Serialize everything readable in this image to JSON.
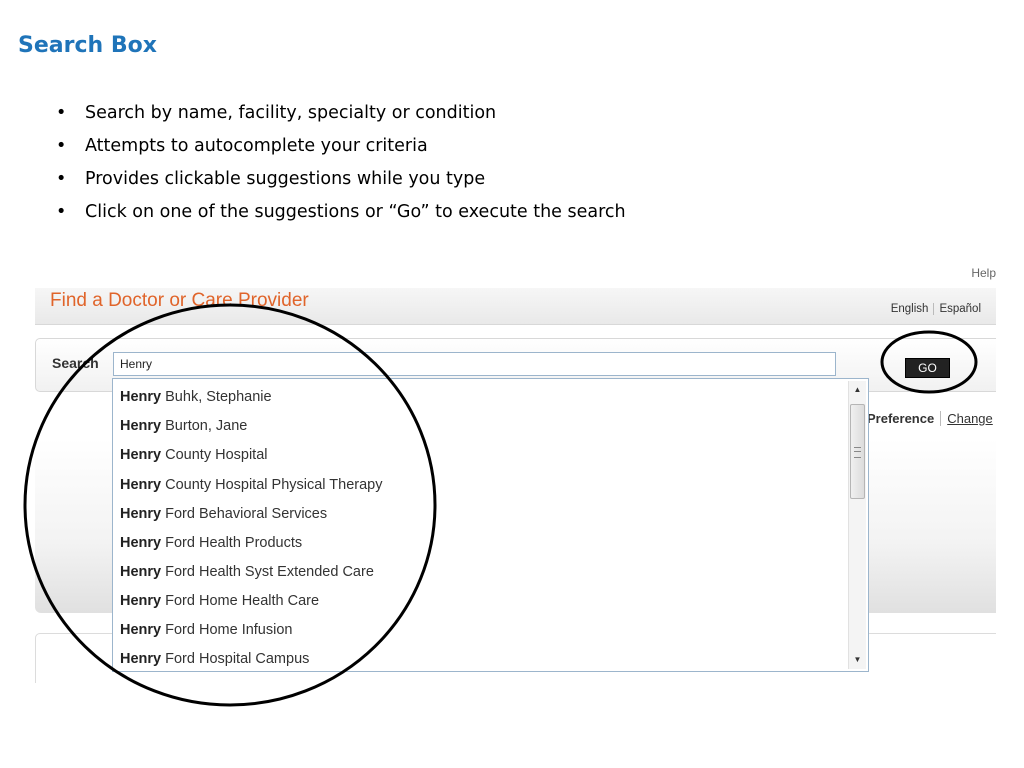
{
  "slide": {
    "title": "Search Box",
    "bullet_char": "•",
    "bullets": [
      "Search by name, facility, specialty or condition",
      "Attempts to autocomplete your criteria",
      "Provides clickable suggestions while you type",
      "Click on one of the suggestions or “Go” to execute the search"
    ]
  },
  "app": {
    "help_link": "Help",
    "title": "Find a Doctor or Care Provider",
    "languages": [
      "English",
      "Español"
    ],
    "search": {
      "label": "Search",
      "value": "Henry",
      "go_label": "GO"
    },
    "preference": {
      "label": "Preference",
      "change_link": "Change"
    },
    "suggestions": {
      "prefix": "Henry",
      "items": [
        "Buhk, Stephanie",
        "Burton, Jane",
        "County Hospital",
        "County Hospital Physical Therapy",
        "Ford Behavioral Services",
        "Ford Health Products",
        "Ford Health Syst Extended Care",
        "Ford Home Health Care",
        "Ford Home Infusion",
        "Ford Hospital Campus"
      ]
    },
    "scroll": {
      "up_glyph": "▲",
      "down_glyph": "▼"
    }
  },
  "colors": {
    "slide_title": "#1f74b9",
    "brand": "#e0642a",
    "go_button": "#222222"
  }
}
